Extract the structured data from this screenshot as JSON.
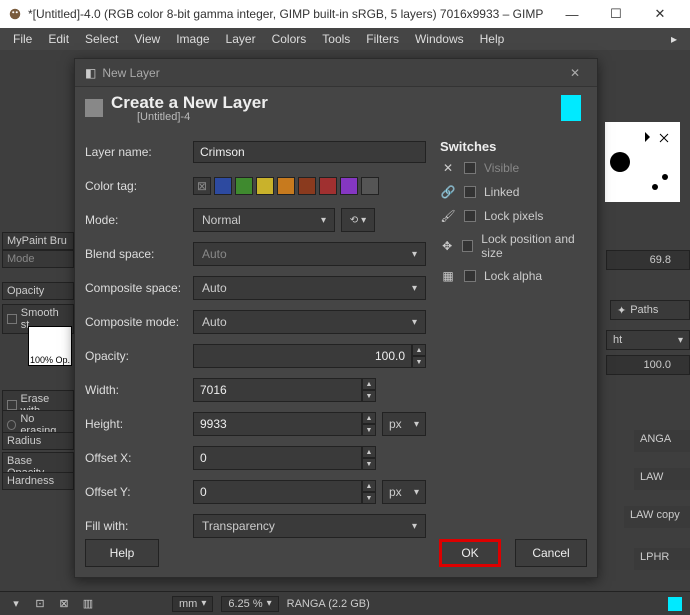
{
  "window": {
    "title": "*[Untitled]-4.0 (RGB color 8-bit gamma integer, GIMP built-in sRGB, 5 layers) 7016x9933 – GIMP"
  },
  "menubar": [
    "File",
    "Edit",
    "Select",
    "View",
    "Image",
    "Layer",
    "Colors",
    "Tools",
    "Filters",
    "Windows",
    "Help"
  ],
  "dialog": {
    "caption": "New Layer",
    "heading": "Create a New Layer",
    "subheading": "[Untitled]-4",
    "labels": {
      "layer_name": "Layer name:",
      "color_tag": "Color tag:",
      "mode": "Mode:",
      "blend_space": "Blend space:",
      "composite_space": "Composite space:",
      "composite_mode": "Composite mode:",
      "opacity": "Opacity:",
      "width": "Width:",
      "height": "Height:",
      "offset_x": "Offset X:",
      "offset_y": "Offset Y:",
      "fill_with": "Fill with:"
    },
    "values": {
      "layer_name": "Crimson",
      "mode": "Normal",
      "blend_space": "Auto",
      "composite_space": "Auto",
      "composite_mode": "Auto",
      "opacity": "100.0",
      "width": "7016",
      "height": "9933",
      "offset_x": "0",
      "offset_y": "0",
      "unit": "px",
      "fill_with": "Transparency"
    },
    "color_tags": [
      "#3a3a3a",
      "#2d4aa0",
      "#3f8a2f",
      "#c9b22b",
      "#c77a1e",
      "#8a3a1e",
      "#a03030",
      "#8537c2",
      "#555555"
    ],
    "switches": {
      "heading": "Switches",
      "items": [
        {
          "icon": "x-icon",
          "label": "Visible",
          "disabled": true
        },
        {
          "icon": "link-icon",
          "label": "Linked",
          "disabled": false
        },
        {
          "icon": "brush-icon",
          "label": "Lock pixels",
          "disabled": false
        },
        {
          "icon": "move-icon",
          "label": "Lock position and size",
          "disabled": false
        },
        {
          "icon": "alpha-icon",
          "label": "Lock alpha",
          "disabled": false
        }
      ]
    },
    "buttons": {
      "help": "Help",
      "ok": "OK",
      "cancel": "Cancel"
    }
  },
  "left_panel": {
    "mypaint": "MyPaint Bru",
    "mode_header": "Mode",
    "opacity_label": "Opacity",
    "smooth": "Smooth st",
    "brush_label": "100% Op.",
    "erase_with": "Erase with",
    "no_erasing": "No erasing",
    "radius": "Radius",
    "base_opacity": "Base Opacity",
    "hardness": "Hardness"
  },
  "right_panel": {
    "spin_value": "69.8",
    "paths_tab": "Paths",
    "pct": "100.0",
    "items": [
      "ANGA",
      "LAW",
      "LAW copy",
      "LPHR"
    ]
  },
  "statusbar": {
    "unit_sel": "mm",
    "zoom": "6.25 %",
    "info": "RANGA (2.2 GB)"
  }
}
